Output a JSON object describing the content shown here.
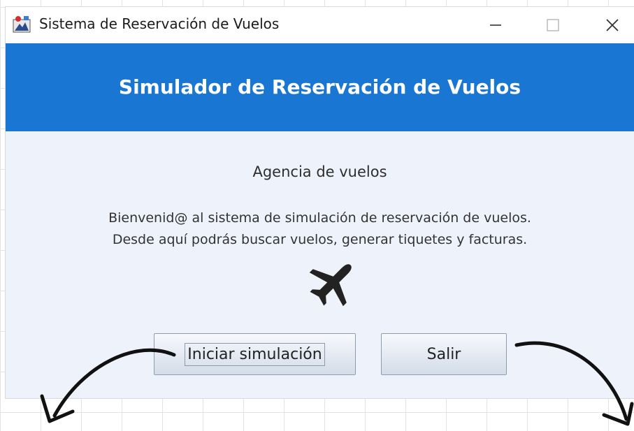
{
  "window": {
    "title": "Sistema de Reservación de Vuelos"
  },
  "header": {
    "title": "Simulador de Reservación de Vuelos",
    "color": "#1976d2"
  },
  "main": {
    "subtitle": "Agencia de vuelos",
    "welcome_line1": "Bienvenid@ al sistema de simulación de reservación de vuelos.",
    "welcome_line2": "Desde aquí podrás buscar vuelos, generar tiquetes y facturas.",
    "icon": "airplane-icon"
  },
  "buttons": {
    "start_label": "Iniciar simulación",
    "exit_label": "Salir"
  }
}
